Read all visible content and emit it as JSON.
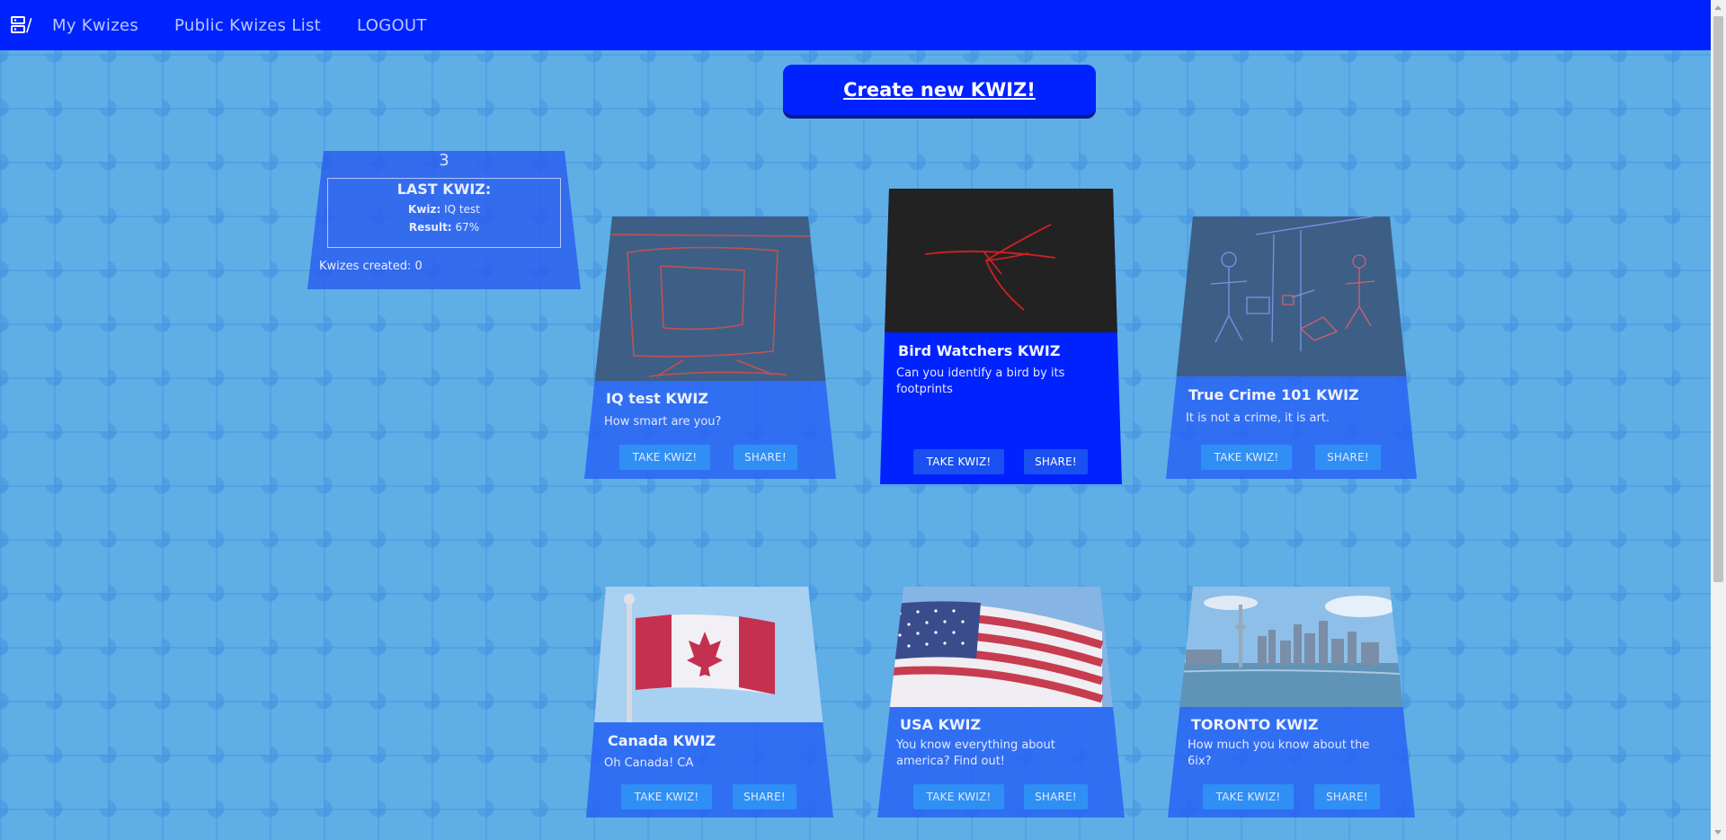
{
  "nav": {
    "links": [
      "My Kwizes",
      "Public Kwizes List",
      "LOGOUT"
    ]
  },
  "create_button": "Create new KWIZ!",
  "stats": {
    "number": "3",
    "title": "LAST KWIZ:",
    "kwiz_label": "Kwiz:",
    "kwiz_value": "IQ test",
    "result_label": "Result:",
    "result_value": "67%",
    "created": "Kwizes created: 0"
  },
  "cards": [
    {
      "title": "IQ test KWIZ",
      "description": "How smart are you?",
      "take_label": "TAKE KWIZ!",
      "share_label": "SHARE!"
    },
    {
      "title": "Bird Watchers KWIZ",
      "description": "Can you identify a bird by its footprints",
      "take_label": "TAKE KWIZ!",
      "share_label": "SHARE!"
    },
    {
      "title": "True Crime 101 KWIZ",
      "description": "It is not a crime, it is art.",
      "take_label": "TAKE KWIZ!",
      "share_label": "SHARE!"
    },
    {
      "title": "Canada KWIZ",
      "description": "Oh Canada! CA",
      "take_label": "TAKE KWIZ!",
      "share_label": "SHARE!"
    },
    {
      "title": "USA KWIZ",
      "description": "You know everything about america? Find out!",
      "take_label": "TAKE KWIZ!",
      "share_label": "SHARE!"
    },
    {
      "title": "TORONTO KWIZ",
      "description": "How much you know about the 6ix?",
      "take_label": "TAKE KWIZ!",
      "share_label": "SHARE!"
    }
  ],
  "colors": {
    "nav": "#0022ff",
    "background": "#5faee6",
    "card": "#265ff5",
    "button": "#2f8ff5"
  }
}
